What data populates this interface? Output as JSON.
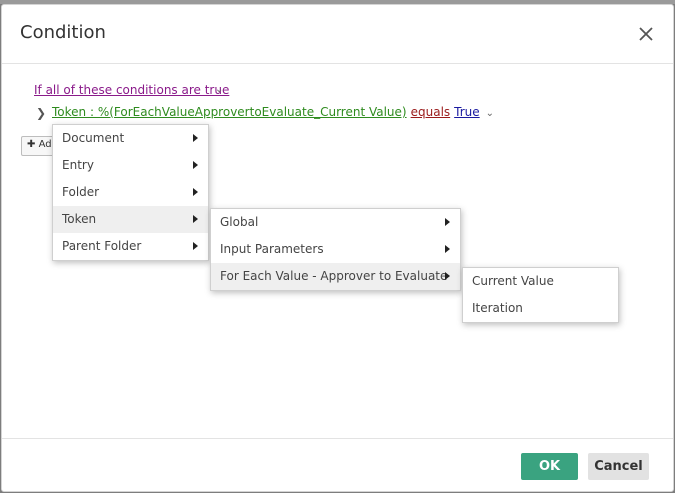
{
  "dialog": {
    "title": "Condition"
  },
  "condition_header": {
    "label": "If all of these conditions are true"
  },
  "condition_row": {
    "token": "Token : %(ForEachValueApprovertoEvaluate_Current Value)",
    "operator": "equals",
    "value": "True"
  },
  "add_button": {
    "label": "Add"
  },
  "menu_level1": {
    "items": [
      "Document",
      "Entry",
      "Folder",
      "Token",
      "Parent Folder"
    ],
    "active_index": 3
  },
  "menu_level2": {
    "items": [
      "Global",
      "Input Parameters",
      "For Each Value - Approver to Evaluate"
    ],
    "active_index": 2
  },
  "menu_level3": {
    "items": [
      "Current Value",
      "Iteration"
    ]
  },
  "footer": {
    "ok_label": "OK",
    "cancel_label": "Cancel"
  },
  "colors": {
    "ok_button": "#3aa380",
    "token_link": "#2e8b1e",
    "operator_link": "#9a1a1a",
    "value_link": "#1a1aa0",
    "header_link": "#8a1a8a"
  }
}
